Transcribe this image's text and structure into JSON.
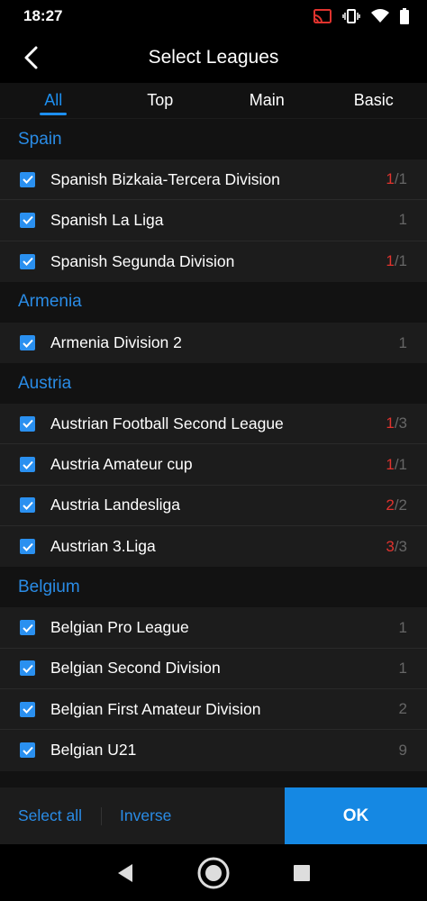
{
  "status_bar": {
    "time": "18:27"
  },
  "header": {
    "title": "Select Leagues"
  },
  "tabs": [
    {
      "label": "All"
    },
    {
      "label": "Top"
    },
    {
      "label": "Main"
    },
    {
      "label": "Basic"
    }
  ],
  "sections": [
    {
      "name": "Spain",
      "items": [
        {
          "label": "Spanish Bizkaia-Tercera Division",
          "selected": "1",
          "total": "/1"
        },
        {
          "label": "Spanish La Liga",
          "selected": "",
          "total": "1"
        },
        {
          "label": "Spanish Segunda Division",
          "selected": "1",
          "total": "/1"
        }
      ]
    },
    {
      "name": "Armenia",
      "items": [
        {
          "label": "Armenia Division 2",
          "selected": "",
          "total": "1"
        }
      ]
    },
    {
      "name": "Austria",
      "items": [
        {
          "label": "Austrian Football Second League",
          "selected": "1",
          "total": "/3"
        },
        {
          "label": "Austria Amateur cup",
          "selected": "1",
          "total": "/1"
        },
        {
          "label": "Austria Landesliga",
          "selected": "2",
          "total": "/2"
        },
        {
          "label": "Austrian 3.Liga",
          "selected": "3",
          "total": "/3"
        }
      ]
    },
    {
      "name": "Belgium",
      "items": [
        {
          "label": "Belgian Pro League",
          "selected": "",
          "total": "1"
        },
        {
          "label": "Belgian Second Division",
          "selected": "",
          "total": "1"
        },
        {
          "label": "Belgian First Amateur Division",
          "selected": "",
          "total": "2"
        },
        {
          "label": "Belgian U21",
          "selected": "",
          "total": "9"
        }
      ]
    }
  ],
  "bottom_bar": {
    "select_all": "Select all",
    "inverse": "Inverse",
    "ok": "OK"
  },
  "colors": {
    "accent": "#1d8ff0",
    "selected_count": "#e0332e",
    "ok_button": "#1588e3"
  }
}
